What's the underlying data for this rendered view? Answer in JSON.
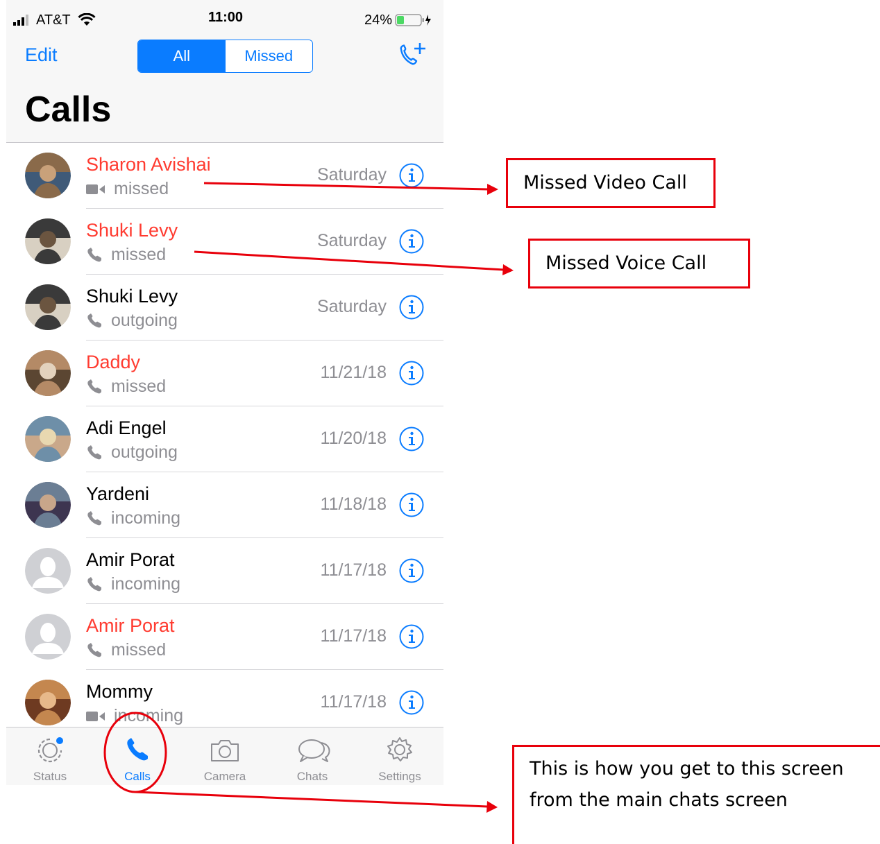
{
  "status_bar": {
    "carrier": "AT&T",
    "time": "11:00",
    "battery": "24%"
  },
  "header": {
    "edit_label": "Edit",
    "segments": [
      "All",
      "Missed"
    ],
    "active_segment": "All",
    "title": "Calls",
    "new_call_icon": "phone-plus-icon"
  },
  "calls": [
    {
      "name": "Sharon Avishai",
      "type": "missed",
      "media": "video",
      "date": "Saturday",
      "missed": true,
      "avatar": "photo"
    },
    {
      "name": "Shuki Levy",
      "type": "missed",
      "media": "voice",
      "date": "Saturday",
      "missed": true,
      "avatar": "photo"
    },
    {
      "name": "Shuki Levy",
      "type": "outgoing",
      "media": "voice",
      "date": "Saturday",
      "missed": false,
      "avatar": "photo"
    },
    {
      "name": "Daddy",
      "type": "missed",
      "media": "voice",
      "date": "11/21/18",
      "missed": true,
      "avatar": "photo"
    },
    {
      "name": "Adi Engel",
      "type": "outgoing",
      "media": "voice",
      "date": "11/20/18",
      "missed": false,
      "avatar": "photo"
    },
    {
      "name": "Yardeni",
      "type": "incoming",
      "media": "voice",
      "date": "11/18/18",
      "missed": false,
      "avatar": "photo"
    },
    {
      "name": "Amir Porat",
      "type": "incoming",
      "media": "voice",
      "date": "11/17/18",
      "missed": false,
      "avatar": "placeholder"
    },
    {
      "name": "Amir Porat",
      "type": "missed",
      "media": "voice",
      "date": "11/17/18",
      "missed": true,
      "avatar": "placeholder"
    },
    {
      "name": "Mommy",
      "type": "incoming",
      "media": "video",
      "date": "11/17/18",
      "missed": false,
      "avatar": "photo"
    }
  ],
  "tabbar": {
    "tabs": [
      {
        "label": "Status",
        "icon": "status-icon"
      },
      {
        "label": "Calls",
        "icon": "phone-icon"
      },
      {
        "label": "Camera",
        "icon": "camera-icon"
      },
      {
        "label": "Chats",
        "icon": "chats-icon"
      },
      {
        "label": "Settings",
        "icon": "gear-icon"
      }
    ],
    "active_tab": "Calls"
  },
  "annotations": {
    "missed_video": "Missed Video Call",
    "missed_voice": "Missed Voice Call",
    "navigation_line1": "This is how you get to this screen",
    "navigation_line2": "from the main chats screen"
  },
  "colors": {
    "accent": "#0a7cff",
    "missed": "#ff3b30",
    "annotation": "#e8000b",
    "secondary_text": "#8e8e93"
  }
}
